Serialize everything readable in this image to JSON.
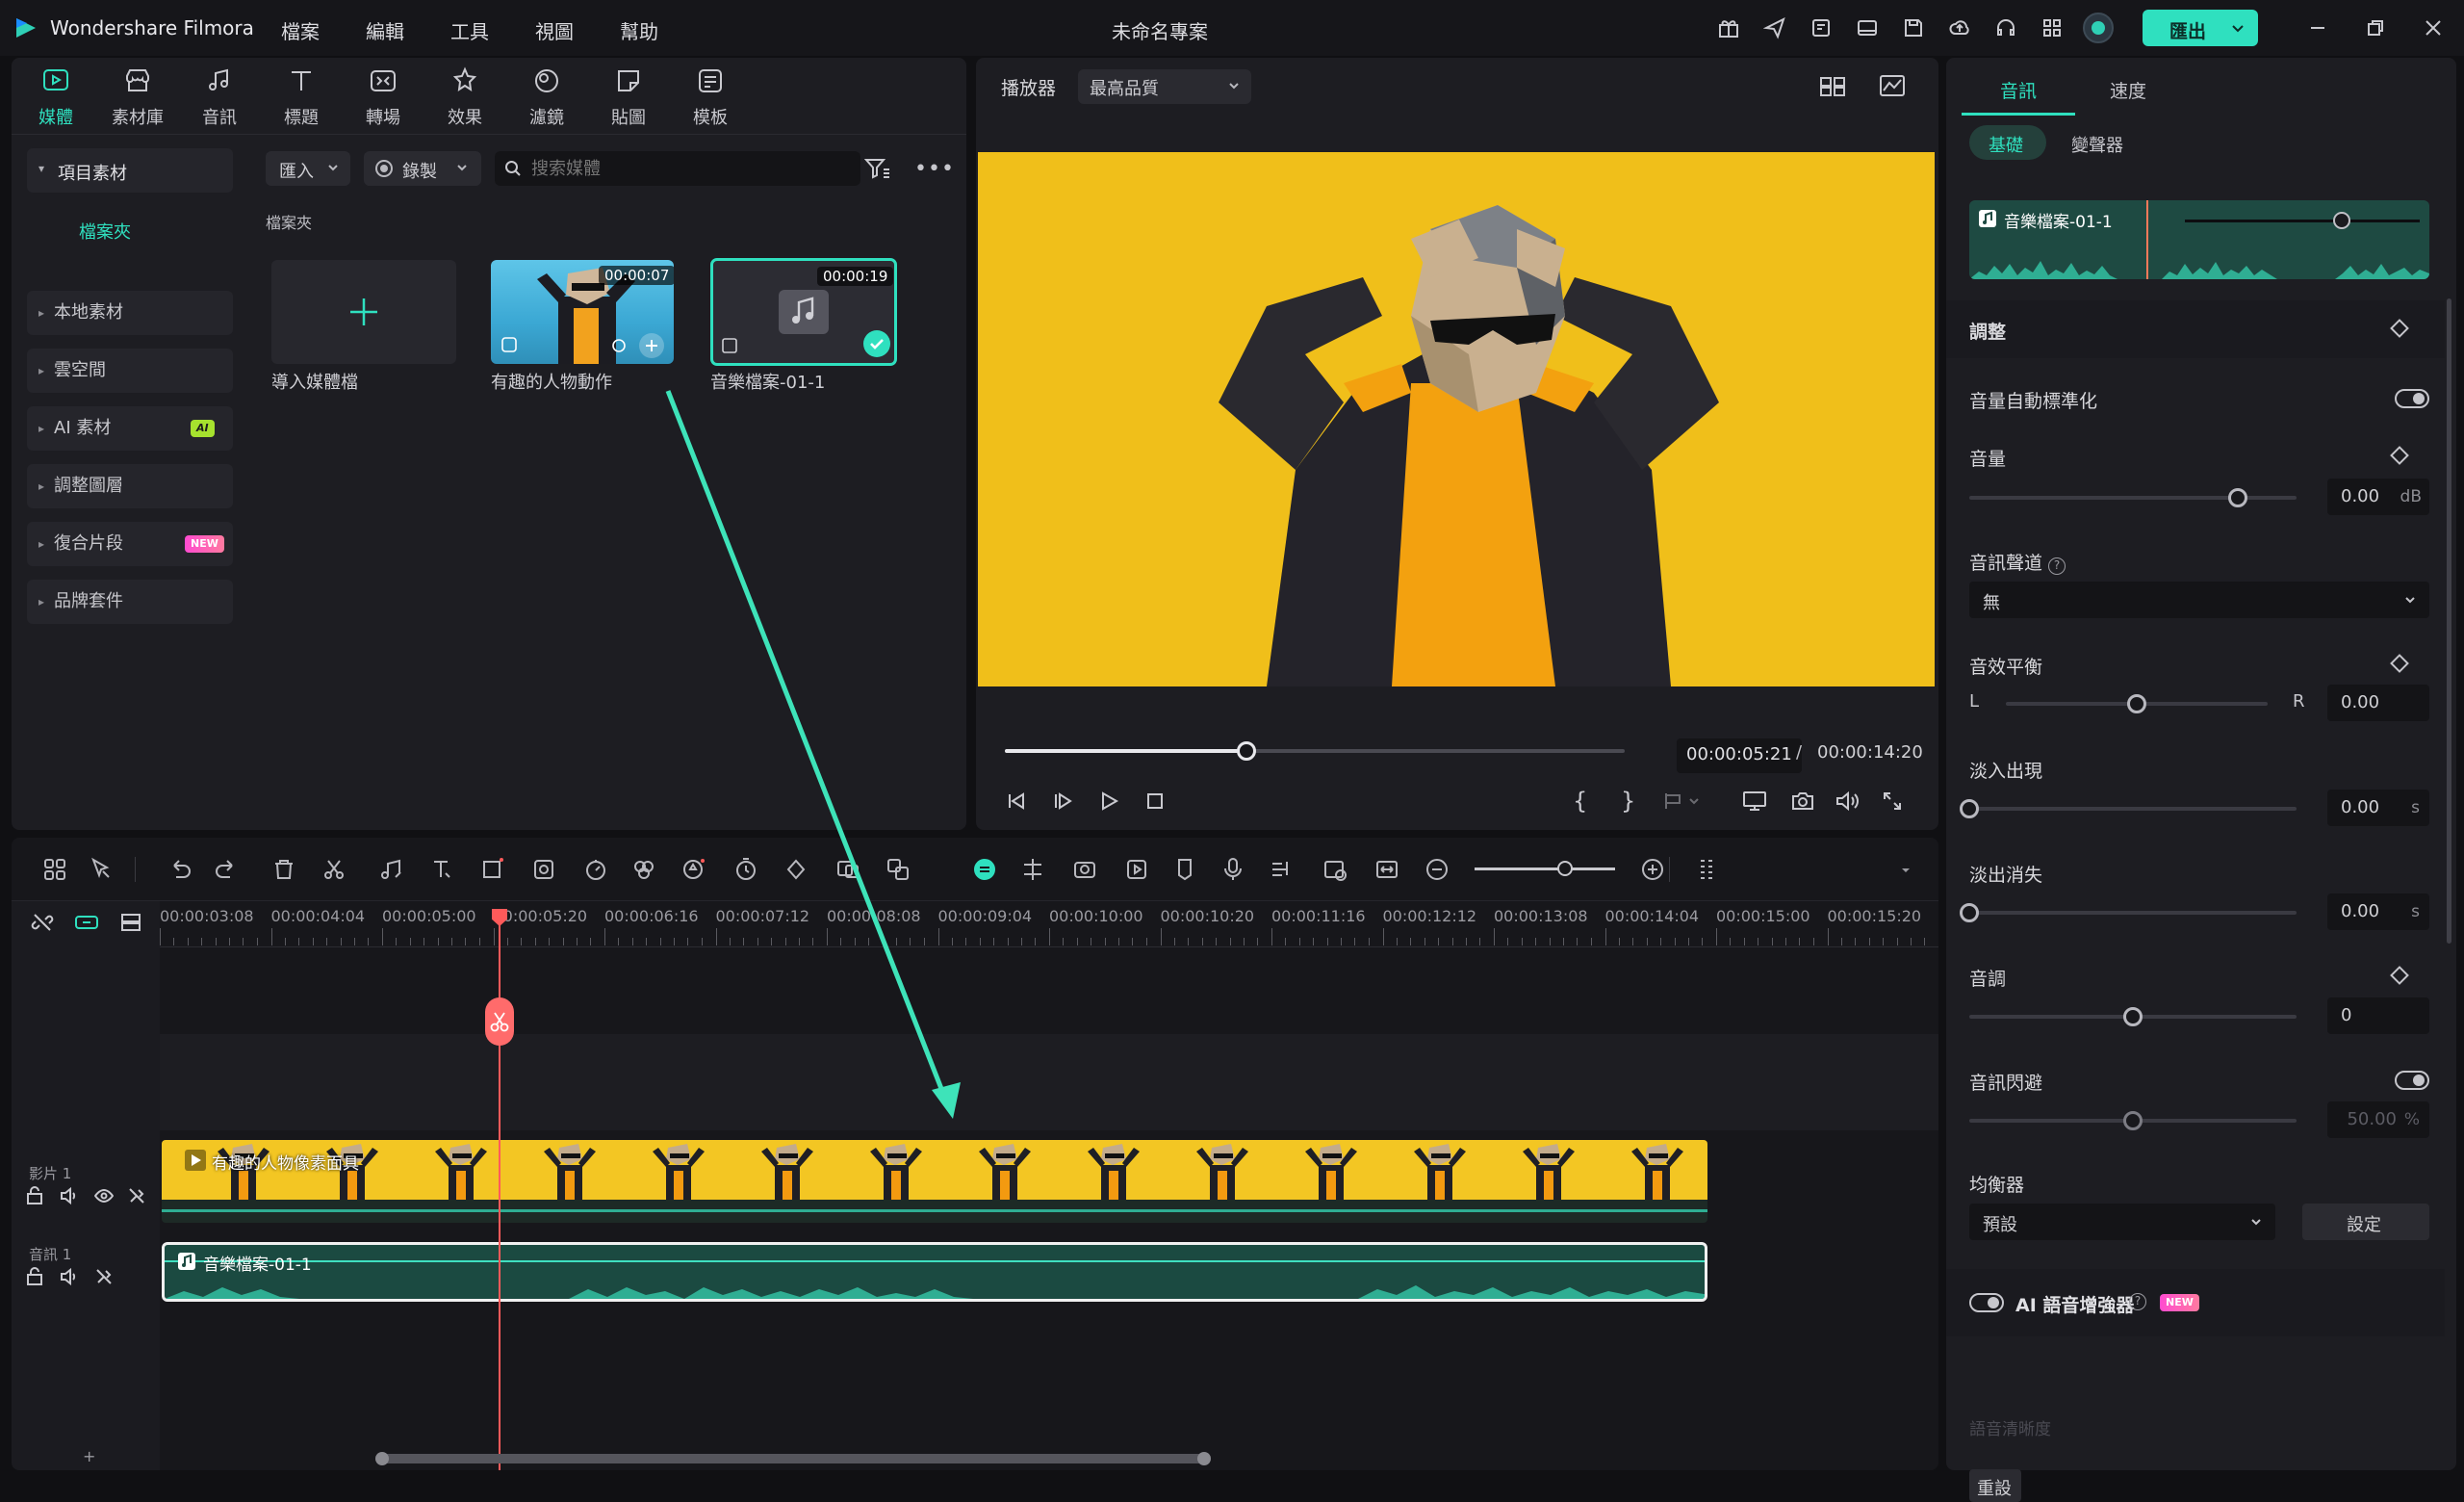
{
  "app": {
    "name": "Wondershare Filmora",
    "project_title": "未命名專案",
    "export_label": "匯出"
  },
  "menu": [
    "檔案",
    "編輯",
    "工具",
    "視圖",
    "幫助"
  ],
  "media_tabs": [
    {
      "label": "媒體",
      "icon": "media-icon",
      "active": true
    },
    {
      "label": "素材庫",
      "icon": "store-icon",
      "active": false
    },
    {
      "label": "音訊",
      "icon": "music-icon",
      "active": false
    },
    {
      "label": "標題",
      "icon": "title-icon",
      "active": false
    },
    {
      "label": "轉場",
      "icon": "transition-icon",
      "active": false
    },
    {
      "label": "效果",
      "icon": "effects-icon",
      "active": false
    },
    {
      "label": "濾鏡",
      "icon": "filter-icon",
      "active": false
    },
    {
      "label": "貼圖",
      "icon": "sticker-icon",
      "active": false
    },
    {
      "label": "模板",
      "icon": "template-icon",
      "active": false
    }
  ],
  "sidebar": {
    "project_media": "項目素材",
    "folder": "檔案夾",
    "items": [
      {
        "label": "本地素材",
        "badge": ""
      },
      {
        "label": "雲空間",
        "badge": ""
      },
      {
        "label": "AI 素材",
        "badge": "AI"
      },
      {
        "label": "調整圖層",
        "badge": ""
      },
      {
        "label": "復合片段",
        "badge": "NEW"
      },
      {
        "label": "品牌套件",
        "badge": ""
      }
    ]
  },
  "media_toolbar": {
    "import_label": "匯入",
    "record_label": "錄製",
    "search_placeholder": "搜索媒體"
  },
  "media_area": {
    "folder_label": "檔案夾",
    "import_tile_label": "導入媒體檔",
    "clips": [
      {
        "name": "有趣的人物動作",
        "duration": "00:00:07",
        "type": "video"
      },
      {
        "name": "音樂檔案-01-1",
        "duration": "00:00:19",
        "type": "audio"
      }
    ]
  },
  "player": {
    "label": "播放器",
    "quality": "最高品質",
    "current_time": "00:00:05:21",
    "separator": "/",
    "total_time": "00:00:14:20",
    "progress": 0.39
  },
  "timeline": {
    "ruler": [
      "00:00:03:08",
      "00:00:04:04",
      "00:00:05:00",
      "00:00:05:20",
      "00:00:06:16",
      "00:00:07:12",
      "00:00:08:08",
      "00:00:09:04",
      "00:00:10:00",
      "00:00:10:20",
      "00:00:11:16",
      "00:00:12:12",
      "00:00:13:08",
      "00:00:14:04",
      "00:00:15:00",
      "00:00:15:20"
    ],
    "video_track_label": "影片 1",
    "audio_track_label": "音訊 1",
    "video_clip_name": "有趣的人物像素面具",
    "audio_clip_name": "音樂檔案-01-1"
  },
  "properties": {
    "tabs": [
      "音訊",
      "速度"
    ],
    "subtabs": [
      "基礎",
      "變聲器"
    ],
    "clip_name": "音樂檔案-01-1",
    "section": "調整",
    "auto_normalize": "音量自動標準化",
    "volume": {
      "label": "音量",
      "value": "0.00",
      "unit": "dB",
      "level": 0.82
    },
    "channel": {
      "label": "音訊聲道",
      "value": "無"
    },
    "balance": {
      "label": "音效平衡",
      "left": "L",
      "right": "R",
      "value": "0.00",
      "level": 0.5
    },
    "fade_in": {
      "label": "淡入出現",
      "value": "0.00",
      "unit": "s",
      "level": 0.0
    },
    "fade_out": {
      "label": "淡出消失",
      "value": "0.00",
      "unit": "s",
      "level": 0.0
    },
    "pitch": {
      "label": "音調",
      "value": "0",
      "level": 0.5
    },
    "ducking": {
      "label": "音訊閃避",
      "value": "50.00",
      "unit": "%",
      "level": 0.5
    },
    "equalizer": {
      "label": "均衡器",
      "value": "預設",
      "button": "設定"
    },
    "ai_enhancer": {
      "label": "AI 語音增強器",
      "badge": "NEW"
    },
    "denoise_label": "語音清晰度",
    "reset_label": "重設"
  },
  "colors": {
    "accent": "#38d6b0",
    "playhead": "#ff5a5a",
    "video_clip": "#f3c623",
    "audio_clip": "#1b4a41"
  }
}
